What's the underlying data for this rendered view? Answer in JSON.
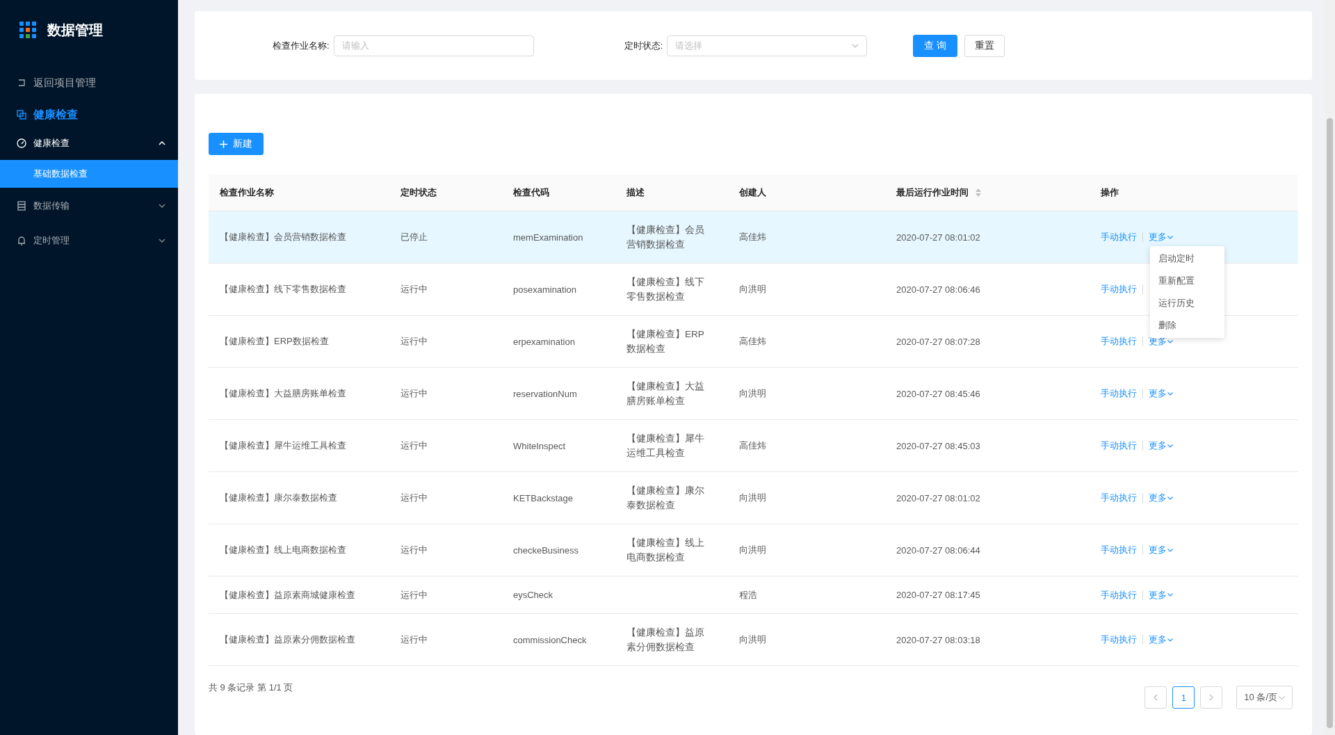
{
  "sidebar": {
    "app_title": "数据管理",
    "back_link": "返回项目管理",
    "section_title": "健康检查",
    "menu": [
      {
        "label": "健康检查",
        "kind": "dashboard",
        "expanded": true,
        "children": [
          {
            "label": "基础数据检查",
            "selected": true
          }
        ]
      },
      {
        "label": "数据传输",
        "kind": "list",
        "expanded": false
      },
      {
        "label": "定时管理",
        "kind": "bell",
        "expanded": false
      }
    ]
  },
  "filters": {
    "fields": [
      {
        "kind": "input",
        "label": "检查作业名称:",
        "placeholder": "请输入"
      },
      {
        "kind": "select",
        "label": "定时状态:",
        "placeholder": "请选择"
      }
    ],
    "search_button": "查 询",
    "reset_button": "重置"
  },
  "new_button": "新建",
  "table": {
    "columns": [
      {
        "label": "检查作业名称",
        "sortable": false
      },
      {
        "label": "定时状态",
        "sortable": false
      },
      {
        "label": "检查代码",
        "sortable": false
      },
      {
        "label": "描述",
        "sortable": false
      },
      {
        "label": "创建人",
        "sortable": false
      },
      {
        "label": "最后运行作业时间",
        "sortable": true
      },
      {
        "label": "操作",
        "sortable": false
      }
    ],
    "rows": [
      {
        "name": "【健康检查】会员营销数据检查",
        "status": "已停止",
        "code": "memExamination",
        "description": "【健康检查】会员营销数据检查",
        "creator": "高佳炜",
        "last_run": "2020-07-27 08:01:02",
        "run_action": "手动执行",
        "more_action": "更多",
        "highlighted": true
      },
      {
        "name": "【健康检查】线下零售数据检查",
        "status": "运行中",
        "code": "posexamination",
        "description": "【健康检查】线下零售数据检查",
        "creator": "向洪明",
        "last_run": "2020-07-27 08:06:46",
        "run_action": "手动执行",
        "highlighted": false
      },
      {
        "name": "【健康检查】ERP数据检查",
        "status": "运行中",
        "code": "erpexamination",
        "description": "【健康检查】ERP数据检查",
        "creator": "高佳炜",
        "last_run": "2020-07-27 08:07:28",
        "run_action": "手动执行",
        "more_action": "更多",
        "highlighted": false
      },
      {
        "name": "【健康检查】大益膳房账单检查",
        "status": "运行中",
        "code": "reservationNum",
        "description": "【健康检查】大益膳房账单检查",
        "creator": "向洪明",
        "last_run": "2020-07-27 08:45:46",
        "run_action": "手动执行",
        "more_action": "更多",
        "highlighted": false
      },
      {
        "name": "【健康检查】犀牛运维工具检查",
        "status": "运行中",
        "code": "WhiteInspect",
        "description": "【健康检查】犀牛运维工具检查",
        "creator": "高佳炜",
        "last_run": "2020-07-27 08:45:03",
        "run_action": "手动执行",
        "more_action": "更多",
        "highlighted": false
      },
      {
        "name": "【健康检查】康尔泰数据检查",
        "status": "运行中",
        "code": "KETBackstage",
        "description": "【健康检查】康尔泰数据检查",
        "creator": "向洪明",
        "last_run": "2020-07-27 08:01:02",
        "run_action": "手动执行",
        "more_action": "更多",
        "highlighted": false
      },
      {
        "name": "【健康检查】线上电商数据检查",
        "status": "运行中",
        "code": "checkeBusiness",
        "description": "【健康检查】线上电商数据检查",
        "creator": "向洪明",
        "last_run": "2020-07-27 08:06:44",
        "run_action": "手动执行",
        "more_action": "更多",
        "highlighted": false
      },
      {
        "name": "【健康检查】益原素商城健康检查",
        "status": "运行中",
        "code": "eysCheck",
        "creator": "程浩",
        "last_run": "2020-07-27 08:17:45",
        "run_action": "手动执行",
        "more_action": "更多",
        "highlighted": false
      },
      {
        "name": "【健康检查】益原素分佣数据检查",
        "status": "运行中",
        "code": "commissionCheck",
        "description": "【健康检查】益原素分佣数据检查",
        "creator": "向洪明",
        "last_run": "2020-07-27 08:03:18",
        "run_action": "手动执行",
        "more_action": "更多",
        "highlighted": false
      }
    ]
  },
  "more_menu": {
    "items": [
      "启动定时",
      "重新配置",
      "运行历史",
      "删除"
    ]
  },
  "footer": {
    "summary": "共 9 条记录 第 1/1 页",
    "pages": [
      {
        "label": "1",
        "selected": true
      }
    ],
    "page_size": "10 条/页"
  }
}
